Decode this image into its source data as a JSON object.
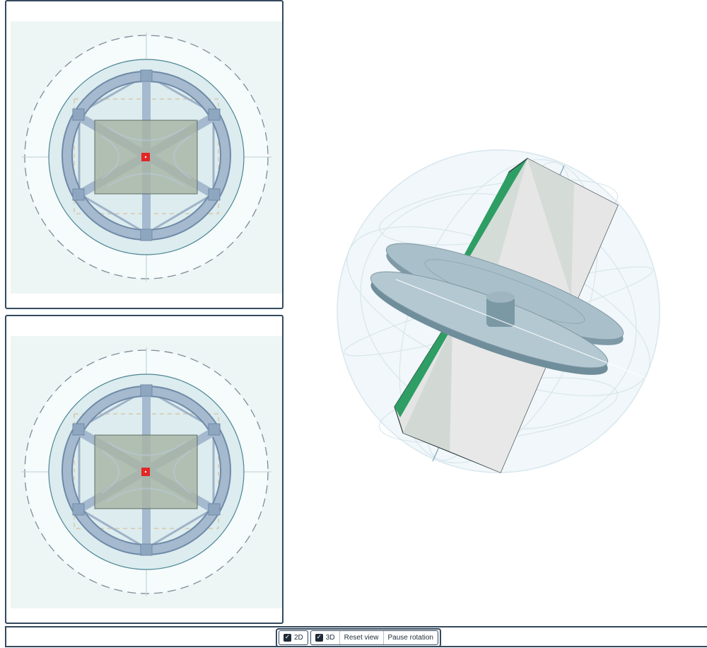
{
  "views": {
    "top_2d": {
      "marker_color": "#e32626"
    },
    "bottom_2d": {
      "marker_color": "#e32626"
    }
  },
  "viewer_3d": {
    "accent_color": "#2e9e64",
    "rotating": true
  },
  "toolbar": {
    "check_2d": {
      "label": "2D",
      "checked": true,
      "icon": "checkmark-icon"
    },
    "check_3d": {
      "label": "3D",
      "checked": true,
      "icon": "checkmark-icon"
    },
    "reset_view_label": "Reset view",
    "pause_rotation_label": "Pause rotation"
  },
  "colors": {
    "border": "#34495e",
    "structure": "#9fb3c8",
    "sensor_plate": "#a7b4a5",
    "background_panel": "#eef5f5"
  }
}
